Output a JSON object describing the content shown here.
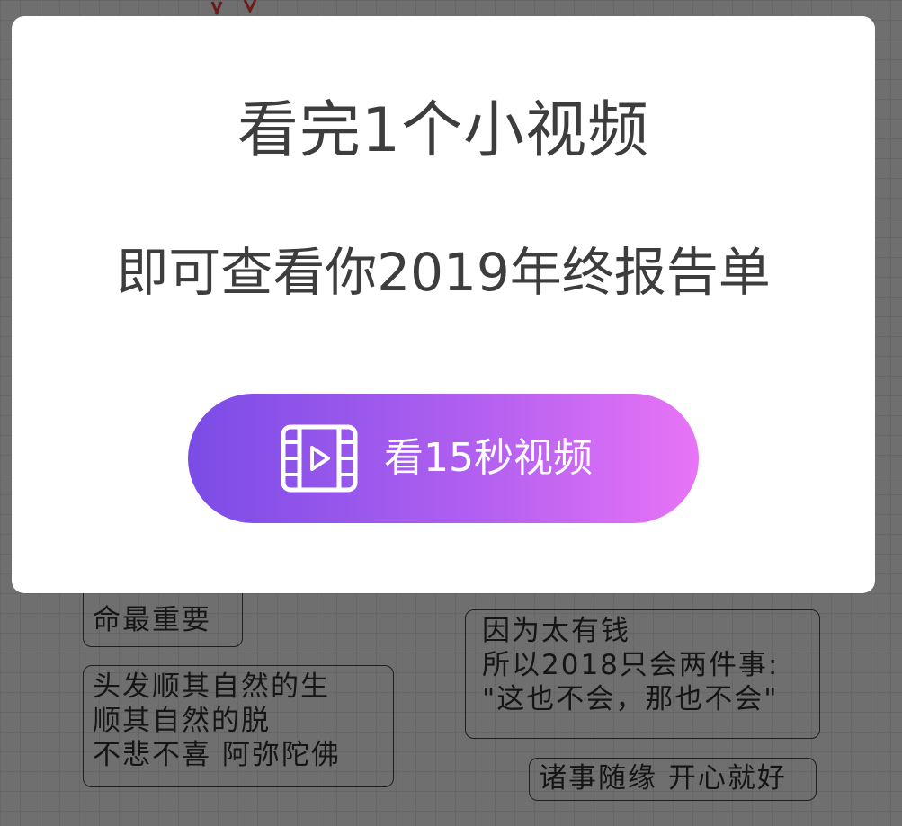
{
  "dialog": {
    "title": "看完1个小视频",
    "subtitle": "即可查看你2019年终报告单",
    "watch_button": {
      "label": "看15秒视频",
      "icon": "film-play-icon"
    }
  },
  "background_notes": [
    {
      "lines": [
        "命最重要"
      ]
    },
    {
      "lines": [
        "头发顺其自然的生",
        "顺其自然的脱",
        "不悲不喜 阿弥陀佛"
      ]
    },
    {
      "lines": [
        "因为太有钱",
        "所以2018只会两件事:",
        "\"这也不会，那也不会\""
      ]
    },
    {
      "lines": [
        "诸事随缘 开心就好"
      ]
    }
  ],
  "colors": {
    "overlay": "#6f6f6f",
    "dialog_bg": "#ffffff",
    "text": "#3d3d3d",
    "button_gradient_start": "#7a4ce6",
    "button_gradient_end": "#e874f6",
    "button_text": "#ffffff"
  }
}
